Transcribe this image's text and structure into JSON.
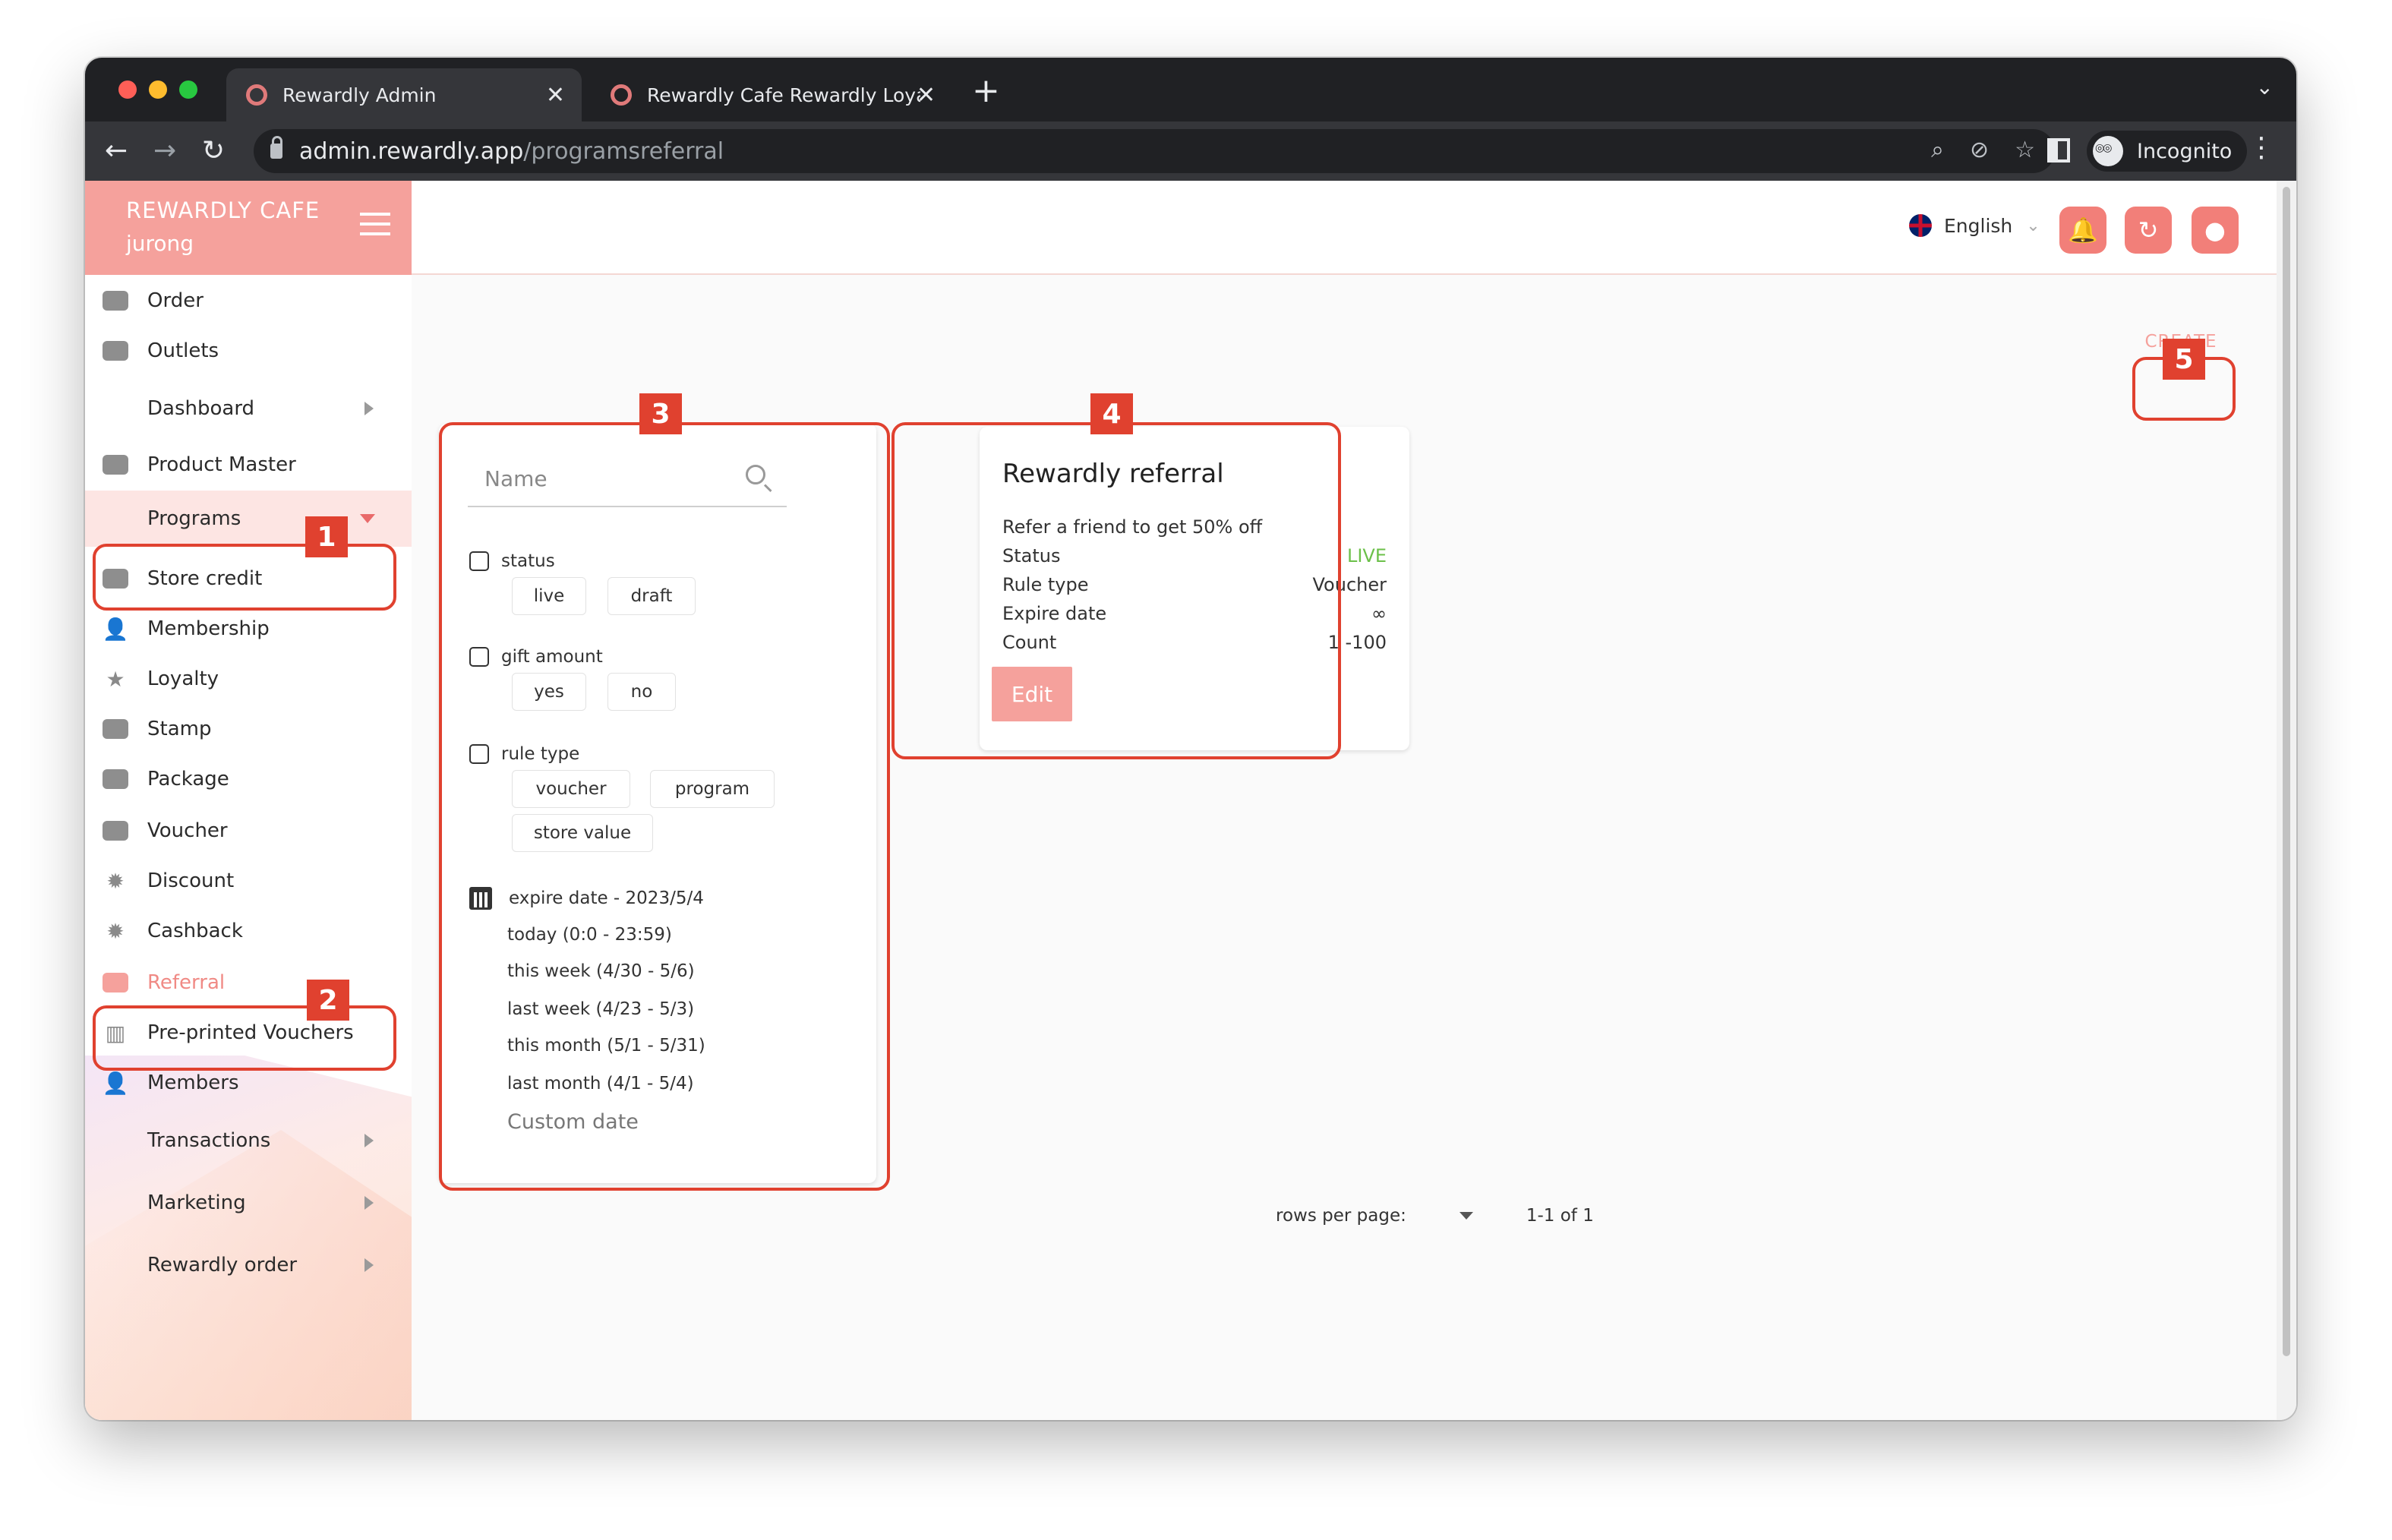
{
  "browser": {
    "tabs": [
      {
        "title": "Rewardly Admin",
        "active": true
      },
      {
        "title": "Rewardly Cafe Rewardly Loyalt",
        "active": false
      }
    ],
    "url_domain": "admin.rewardly.app",
    "url_path": "/programsreferral",
    "incognito_label": "Incognito",
    "new_tab": "+",
    "close": "✕"
  },
  "brand": {
    "name": "REWARDLY CAFE",
    "outlet": "jurong"
  },
  "sidebar": {
    "items": [
      {
        "label": "Order",
        "icon": "order-icon"
      },
      {
        "label": "Outlets",
        "icon": "outlets-icon"
      },
      {
        "label": "Dashboard",
        "icon": ""
      },
      {
        "label": "Product Master",
        "icon": "cube-icon"
      },
      {
        "label": "Programs",
        "icon": ""
      },
      {
        "label": "Store credit",
        "icon": "card-icon"
      },
      {
        "label": "Membership",
        "icon": "membership-icon"
      },
      {
        "label": "Loyalty",
        "icon": "star-icon"
      },
      {
        "label": "Stamp",
        "icon": "stamp-icon"
      },
      {
        "label": "Package",
        "icon": "package-icon"
      },
      {
        "label": "Voucher",
        "icon": "voucher-icon"
      },
      {
        "label": "Discount",
        "icon": "discount-icon"
      },
      {
        "label": "Cashback",
        "icon": "cashback-icon"
      },
      {
        "label": "Referral",
        "icon": "referral-icon"
      },
      {
        "label": "Pre-printed Vouchers",
        "icon": "barcode-icon"
      },
      {
        "label": "Members",
        "icon": "members-icon"
      },
      {
        "label": "Transactions",
        "icon": ""
      },
      {
        "label": "Marketing",
        "icon": ""
      },
      {
        "label": "Rewardly order",
        "icon": ""
      }
    ]
  },
  "header": {
    "language": "English"
  },
  "create_label": "CREATE",
  "annotations": [
    "1",
    "2",
    "3",
    "4",
    "5"
  ],
  "filters": {
    "search_placeholder": "Name",
    "status": {
      "title": "status",
      "options": [
        "live",
        "draft"
      ]
    },
    "gift_amount": {
      "title": "gift amount",
      "options": [
        "yes",
        "no"
      ]
    },
    "rule_type": {
      "title": "rule type",
      "options": [
        "voucher",
        "program",
        "store value"
      ]
    },
    "expire_date": {
      "title": "expire date - 2023/5/4",
      "options": [
        "today (0:0 - 23:59)",
        "this week (4/30 - 5/6)",
        "last week (4/23 - 5/3)",
        "this month (5/1 - 5/31)",
        "last month (4/1 - 5/4)"
      ],
      "custom": "Custom date"
    }
  },
  "program": {
    "title": "Rewardly referral",
    "description": "Refer a friend to get 50% off",
    "rows": [
      {
        "label": "Status",
        "value": "LIVE"
      },
      {
        "label": "Rule type",
        "value": "Voucher"
      },
      {
        "label": "Expire date",
        "value": "∞"
      },
      {
        "label": "Count",
        "value": "1 -100"
      }
    ],
    "edit_label": "Edit"
  },
  "pagination": {
    "rows_per_page": "rows per page:",
    "range": "1-1 of 1"
  },
  "colors": {
    "brand": "#f5a19c",
    "accent": "#f27f79",
    "annotation": "#e0412f",
    "live": "#6cc04a"
  }
}
